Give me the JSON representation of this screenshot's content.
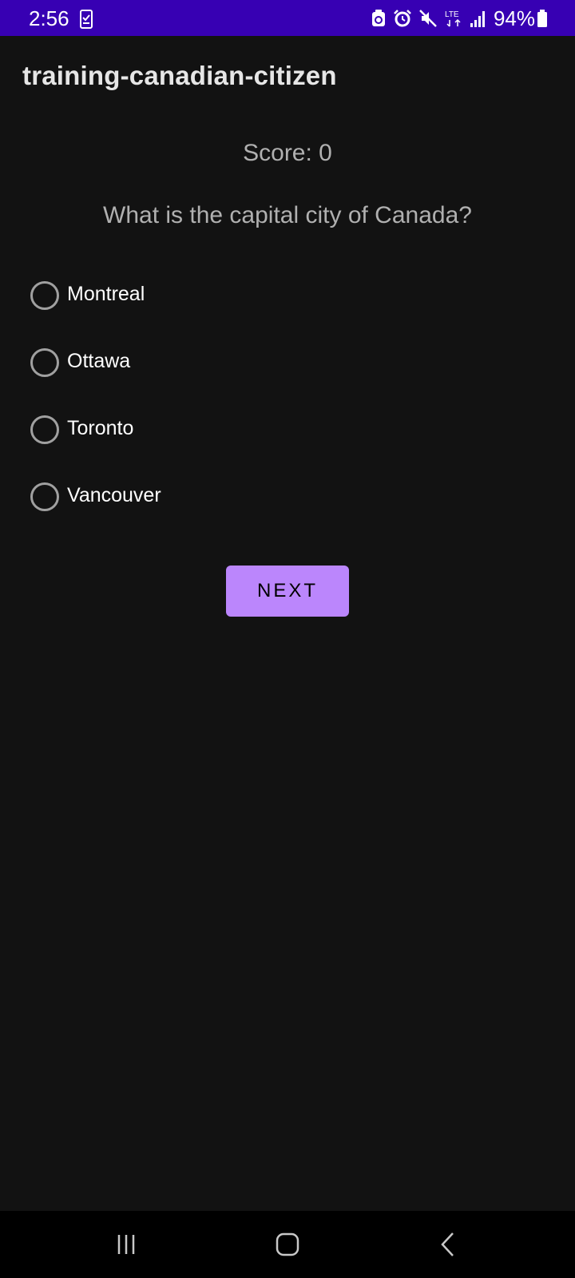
{
  "status_bar": {
    "time": "2:56",
    "battery_text": "94%",
    "signal_text": "LTE",
    "background_color": "#3700b3",
    "icons": [
      "clipboard-check-icon",
      "recycle-icon",
      "alarm-icon",
      "mute-icon",
      "lte-icon",
      "signal-icon",
      "battery-icon"
    ]
  },
  "app_bar": {
    "title": "training-canadian-citizen"
  },
  "quiz": {
    "score_text": "Score: 0",
    "question": "What is the capital city of Canada?",
    "options": [
      {
        "label": "Montreal",
        "selected": false
      },
      {
        "label": "Ottawa",
        "selected": false
      },
      {
        "label": "Toronto",
        "selected": false
      },
      {
        "label": "Vancouver",
        "selected": false
      }
    ],
    "next_label": "NEXT",
    "accent_color": "#bb86fc"
  },
  "nav_bar": {
    "icons": [
      "recent-apps-icon",
      "home-icon",
      "back-icon"
    ]
  }
}
